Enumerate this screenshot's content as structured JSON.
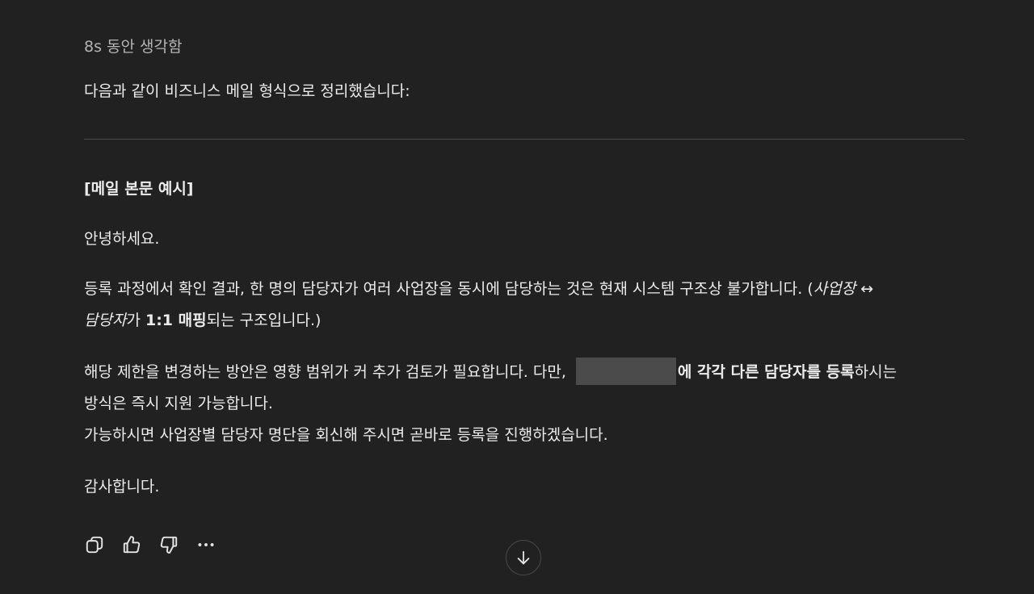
{
  "thinking_label": "8s 동안 생각함",
  "intro": "다음과 같이 비즈니스 메일 형식으로 정리했습니다:",
  "mail": {
    "heading": "[메일 본문 예시]",
    "greeting": "안녕하세요.",
    "registration": {
      "line1_text": "등록 과정에서 확인 결과, 한 명의 담당자가 여러 사업장을 동시에 담당하는 것은 현재 시스템 구조상 불가합니다. (",
      "line1_italic": "사업장 ↔",
      "line2_italic": "담당자",
      "line2_text_a": "가 ",
      "line2_bold": "1:1 매핑",
      "line2_text_b": "되는 구조입니다.)"
    },
    "limitation": {
      "line1_text": "해당 제한을 변경하는 방안은 영향 범위가 커 추가 검토가 필요합니다. 다만, ",
      "line1_bold": "에 각각 다른 담당자를 등록",
      "line1_tail": "하시는",
      "line2": "방식은 즉시 지원 가능합니다.",
      "line3": "가능하시면 사업장별 담당자 명단을 회신해 주시면 곧바로 등록을 진행하겠습니다."
    },
    "closing": "감사합니다."
  },
  "actions": {
    "copy_icon": "copy-icon",
    "like_icon": "thumbs-up-icon",
    "dislike_icon": "thumbs-down-icon",
    "more_icon": "more-icon"
  },
  "scroll_icon": "arrow-down-icon",
  "colors": {
    "background": "#212121",
    "text": "#ececec",
    "muted": "#b4b4b4",
    "divider": "#4a4a4a",
    "redaction": "#4b4b4b"
  }
}
